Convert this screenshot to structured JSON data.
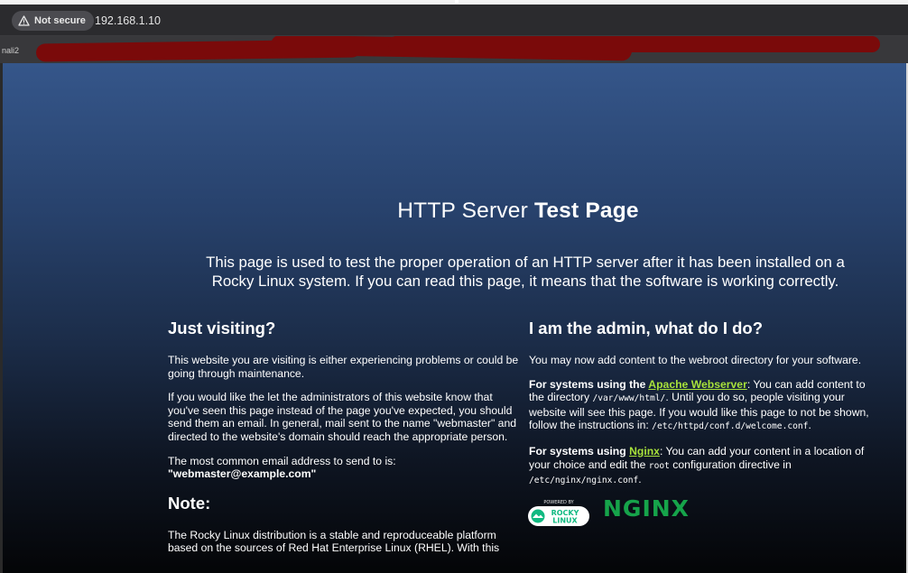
{
  "browser": {
    "security_label": "Not secure",
    "url": "192.168.1.10",
    "bookmark_fragment": "nali2"
  },
  "page": {
    "title_normal": "HTTP Server ",
    "title_bold": "Test Page",
    "intro": "This page is used to test the proper operation of an HTTP server after it has been installed on a Rocky Linux system. If you can read this page, it means that the software is working correctly.",
    "left": {
      "heading": "Just visiting?",
      "p1": "This website you are visiting is either experiencing problems or could be going through maintenance.",
      "p2": "If you would like the let the administrators of this website know that you've seen this page instead of the page you've expected, you should send them an email. In general, mail sent to the name \"webmaster\" and directed to the website's domain should reach the appropriate person.",
      "p3": "The most common email address to send to is:",
      "email": "\"webmaster@example.com\"",
      "note_heading": "Note:",
      "note_text": "The Rocky Linux distribution is a stable and reproduceable platform based on the sources of Red Hat Enterprise Linux (RHEL). With this"
    },
    "right": {
      "heading": "I am the admin, what do I do?",
      "p1": "You may now add content to the webroot directory for your software.",
      "apache_lead": "For systems using the ",
      "apache_link": "Apache Webserver",
      "apache_text1": ": You can add content to the directory ",
      "apache_path": "/var/www/html/",
      "apache_text2": ". Until you do so, people visiting your website will see this page. If you would like this page to not be shown, follow the instructions in: ",
      "apache_conf": "/etc/httpd/conf.d/welcome.conf",
      "apache_end": ".",
      "nginx_lead": "For systems using ",
      "nginx_link": "Nginx",
      "nginx_text1": ": You can add your content in a location of your choice and edit the ",
      "nginx_root": "root",
      "nginx_text2": " configuration directive in ",
      "nginx_conf": "/etc/nginx/nginx.conf",
      "nginx_end": ".",
      "rocky_powered": "POWERED BY",
      "rocky_name_1": "ROCKY",
      "rocky_name_2": "LINUX",
      "nginx_logo": "NGINX"
    }
  },
  "colors": {
    "link": "#a8e23b",
    "nginx_logo": "#16a34a",
    "redaction": "#7a0a0a"
  }
}
